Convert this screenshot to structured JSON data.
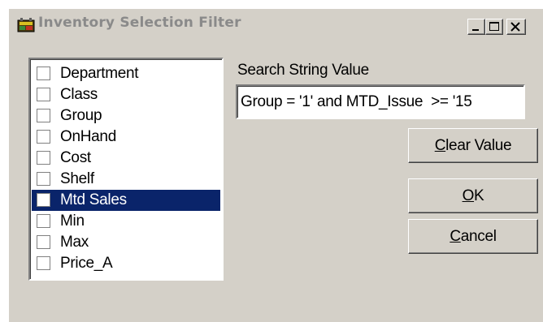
{
  "window": {
    "title": "Inventory Selection Filter"
  },
  "titlebar_buttons": {
    "minimize": "minimize-icon",
    "maximize": "maximize-icon",
    "close": "close-icon"
  },
  "fields_list": {
    "items": [
      {
        "label": "Department",
        "checked": false,
        "selected": false
      },
      {
        "label": "Class",
        "checked": false,
        "selected": false
      },
      {
        "label": "Group",
        "checked": false,
        "selected": false
      },
      {
        "label": "OnHand",
        "checked": false,
        "selected": false
      },
      {
        "label": "Cost",
        "checked": false,
        "selected": false
      },
      {
        "label": "Shelf",
        "checked": false,
        "selected": false
      },
      {
        "label": "Mtd Sales",
        "checked": false,
        "selected": true
      },
      {
        "label": "Min",
        "checked": false,
        "selected": false
      },
      {
        "label": "Max",
        "checked": false,
        "selected": false
      },
      {
        "label": "Price_A",
        "checked": false,
        "selected": false
      }
    ]
  },
  "search": {
    "label": "Search String Value",
    "value": "Group = '1' and MTD_Issue  >= '15"
  },
  "buttons": {
    "clear_value": {
      "mnemonic": "C",
      "rest": "lear Value"
    },
    "ok": {
      "mnemonic": "O",
      "rest": "K"
    },
    "cancel": {
      "mnemonic": "C",
      "rest": "ancel"
    }
  },
  "colors": {
    "face": "#d4d0c8",
    "selection": "#0a246a",
    "title_text_inactive": "#8a8a8a"
  }
}
